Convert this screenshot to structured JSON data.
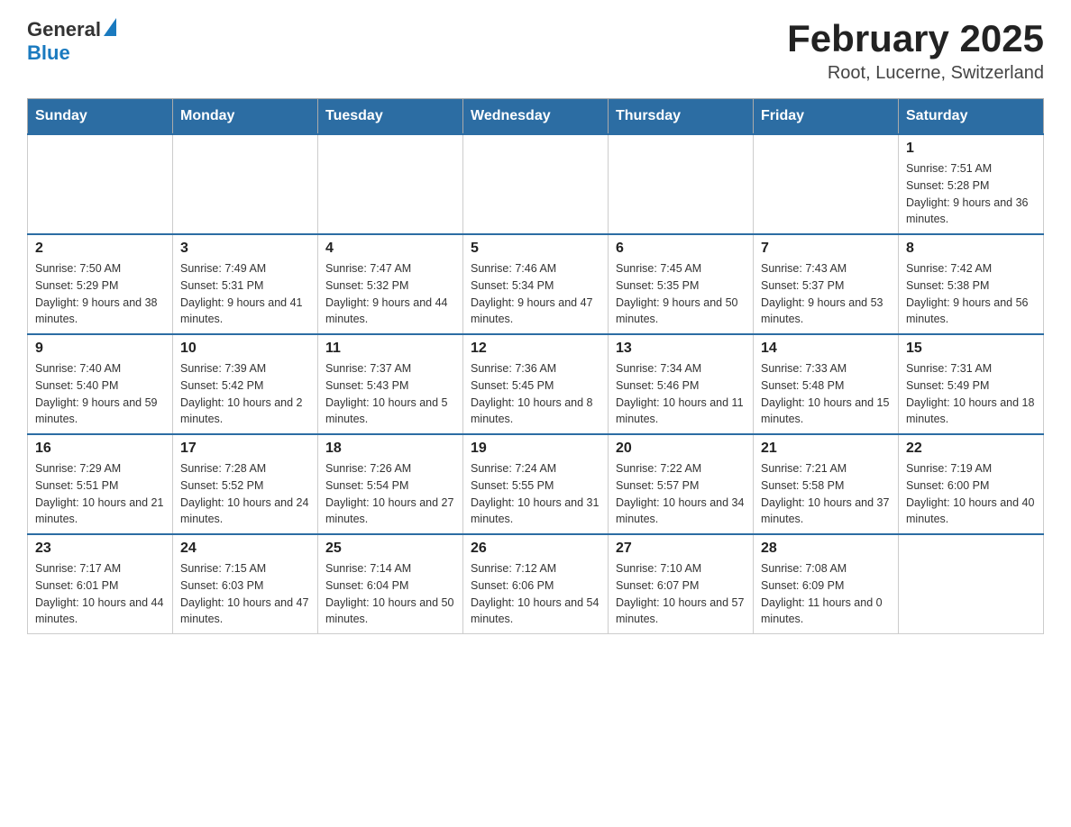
{
  "header": {
    "title": "February 2025",
    "subtitle": "Root, Lucerne, Switzerland",
    "logo_general": "General",
    "logo_blue": "Blue"
  },
  "days_of_week": [
    "Sunday",
    "Monday",
    "Tuesday",
    "Wednesday",
    "Thursday",
    "Friday",
    "Saturday"
  ],
  "weeks": [
    {
      "days": [
        {
          "number": "",
          "empty": true
        },
        {
          "number": "",
          "empty": true
        },
        {
          "number": "",
          "empty": true
        },
        {
          "number": "",
          "empty": true
        },
        {
          "number": "",
          "empty": true
        },
        {
          "number": "",
          "empty": true
        },
        {
          "number": "1",
          "sunrise": "Sunrise: 7:51 AM",
          "sunset": "Sunset: 5:28 PM",
          "daylight": "Daylight: 9 hours and 36 minutes."
        }
      ]
    },
    {
      "days": [
        {
          "number": "2",
          "sunrise": "Sunrise: 7:50 AM",
          "sunset": "Sunset: 5:29 PM",
          "daylight": "Daylight: 9 hours and 38 minutes."
        },
        {
          "number": "3",
          "sunrise": "Sunrise: 7:49 AM",
          "sunset": "Sunset: 5:31 PM",
          "daylight": "Daylight: 9 hours and 41 minutes."
        },
        {
          "number": "4",
          "sunrise": "Sunrise: 7:47 AM",
          "sunset": "Sunset: 5:32 PM",
          "daylight": "Daylight: 9 hours and 44 minutes."
        },
        {
          "number": "5",
          "sunrise": "Sunrise: 7:46 AM",
          "sunset": "Sunset: 5:34 PM",
          "daylight": "Daylight: 9 hours and 47 minutes."
        },
        {
          "number": "6",
          "sunrise": "Sunrise: 7:45 AM",
          "sunset": "Sunset: 5:35 PM",
          "daylight": "Daylight: 9 hours and 50 minutes."
        },
        {
          "number": "7",
          "sunrise": "Sunrise: 7:43 AM",
          "sunset": "Sunset: 5:37 PM",
          "daylight": "Daylight: 9 hours and 53 minutes."
        },
        {
          "number": "8",
          "sunrise": "Sunrise: 7:42 AM",
          "sunset": "Sunset: 5:38 PM",
          "daylight": "Daylight: 9 hours and 56 minutes."
        }
      ]
    },
    {
      "days": [
        {
          "number": "9",
          "sunrise": "Sunrise: 7:40 AM",
          "sunset": "Sunset: 5:40 PM",
          "daylight": "Daylight: 9 hours and 59 minutes."
        },
        {
          "number": "10",
          "sunrise": "Sunrise: 7:39 AM",
          "sunset": "Sunset: 5:42 PM",
          "daylight": "Daylight: 10 hours and 2 minutes."
        },
        {
          "number": "11",
          "sunrise": "Sunrise: 7:37 AM",
          "sunset": "Sunset: 5:43 PM",
          "daylight": "Daylight: 10 hours and 5 minutes."
        },
        {
          "number": "12",
          "sunrise": "Sunrise: 7:36 AM",
          "sunset": "Sunset: 5:45 PM",
          "daylight": "Daylight: 10 hours and 8 minutes."
        },
        {
          "number": "13",
          "sunrise": "Sunrise: 7:34 AM",
          "sunset": "Sunset: 5:46 PM",
          "daylight": "Daylight: 10 hours and 11 minutes."
        },
        {
          "number": "14",
          "sunrise": "Sunrise: 7:33 AM",
          "sunset": "Sunset: 5:48 PM",
          "daylight": "Daylight: 10 hours and 15 minutes."
        },
        {
          "number": "15",
          "sunrise": "Sunrise: 7:31 AM",
          "sunset": "Sunset: 5:49 PM",
          "daylight": "Daylight: 10 hours and 18 minutes."
        }
      ]
    },
    {
      "days": [
        {
          "number": "16",
          "sunrise": "Sunrise: 7:29 AM",
          "sunset": "Sunset: 5:51 PM",
          "daylight": "Daylight: 10 hours and 21 minutes."
        },
        {
          "number": "17",
          "sunrise": "Sunrise: 7:28 AM",
          "sunset": "Sunset: 5:52 PM",
          "daylight": "Daylight: 10 hours and 24 minutes."
        },
        {
          "number": "18",
          "sunrise": "Sunrise: 7:26 AM",
          "sunset": "Sunset: 5:54 PM",
          "daylight": "Daylight: 10 hours and 27 minutes."
        },
        {
          "number": "19",
          "sunrise": "Sunrise: 7:24 AM",
          "sunset": "Sunset: 5:55 PM",
          "daylight": "Daylight: 10 hours and 31 minutes."
        },
        {
          "number": "20",
          "sunrise": "Sunrise: 7:22 AM",
          "sunset": "Sunset: 5:57 PM",
          "daylight": "Daylight: 10 hours and 34 minutes."
        },
        {
          "number": "21",
          "sunrise": "Sunrise: 7:21 AM",
          "sunset": "Sunset: 5:58 PM",
          "daylight": "Daylight: 10 hours and 37 minutes."
        },
        {
          "number": "22",
          "sunrise": "Sunrise: 7:19 AM",
          "sunset": "Sunset: 6:00 PM",
          "daylight": "Daylight: 10 hours and 40 minutes."
        }
      ]
    },
    {
      "days": [
        {
          "number": "23",
          "sunrise": "Sunrise: 7:17 AM",
          "sunset": "Sunset: 6:01 PM",
          "daylight": "Daylight: 10 hours and 44 minutes."
        },
        {
          "number": "24",
          "sunrise": "Sunrise: 7:15 AM",
          "sunset": "Sunset: 6:03 PM",
          "daylight": "Daylight: 10 hours and 47 minutes."
        },
        {
          "number": "25",
          "sunrise": "Sunrise: 7:14 AM",
          "sunset": "Sunset: 6:04 PM",
          "daylight": "Daylight: 10 hours and 50 minutes."
        },
        {
          "number": "26",
          "sunrise": "Sunrise: 7:12 AM",
          "sunset": "Sunset: 6:06 PM",
          "daylight": "Daylight: 10 hours and 54 minutes."
        },
        {
          "number": "27",
          "sunrise": "Sunrise: 7:10 AM",
          "sunset": "Sunset: 6:07 PM",
          "daylight": "Daylight: 10 hours and 57 minutes."
        },
        {
          "number": "28",
          "sunrise": "Sunrise: 7:08 AM",
          "sunset": "Sunset: 6:09 PM",
          "daylight": "Daylight: 11 hours and 0 minutes."
        },
        {
          "number": "",
          "empty": true
        }
      ]
    }
  ]
}
